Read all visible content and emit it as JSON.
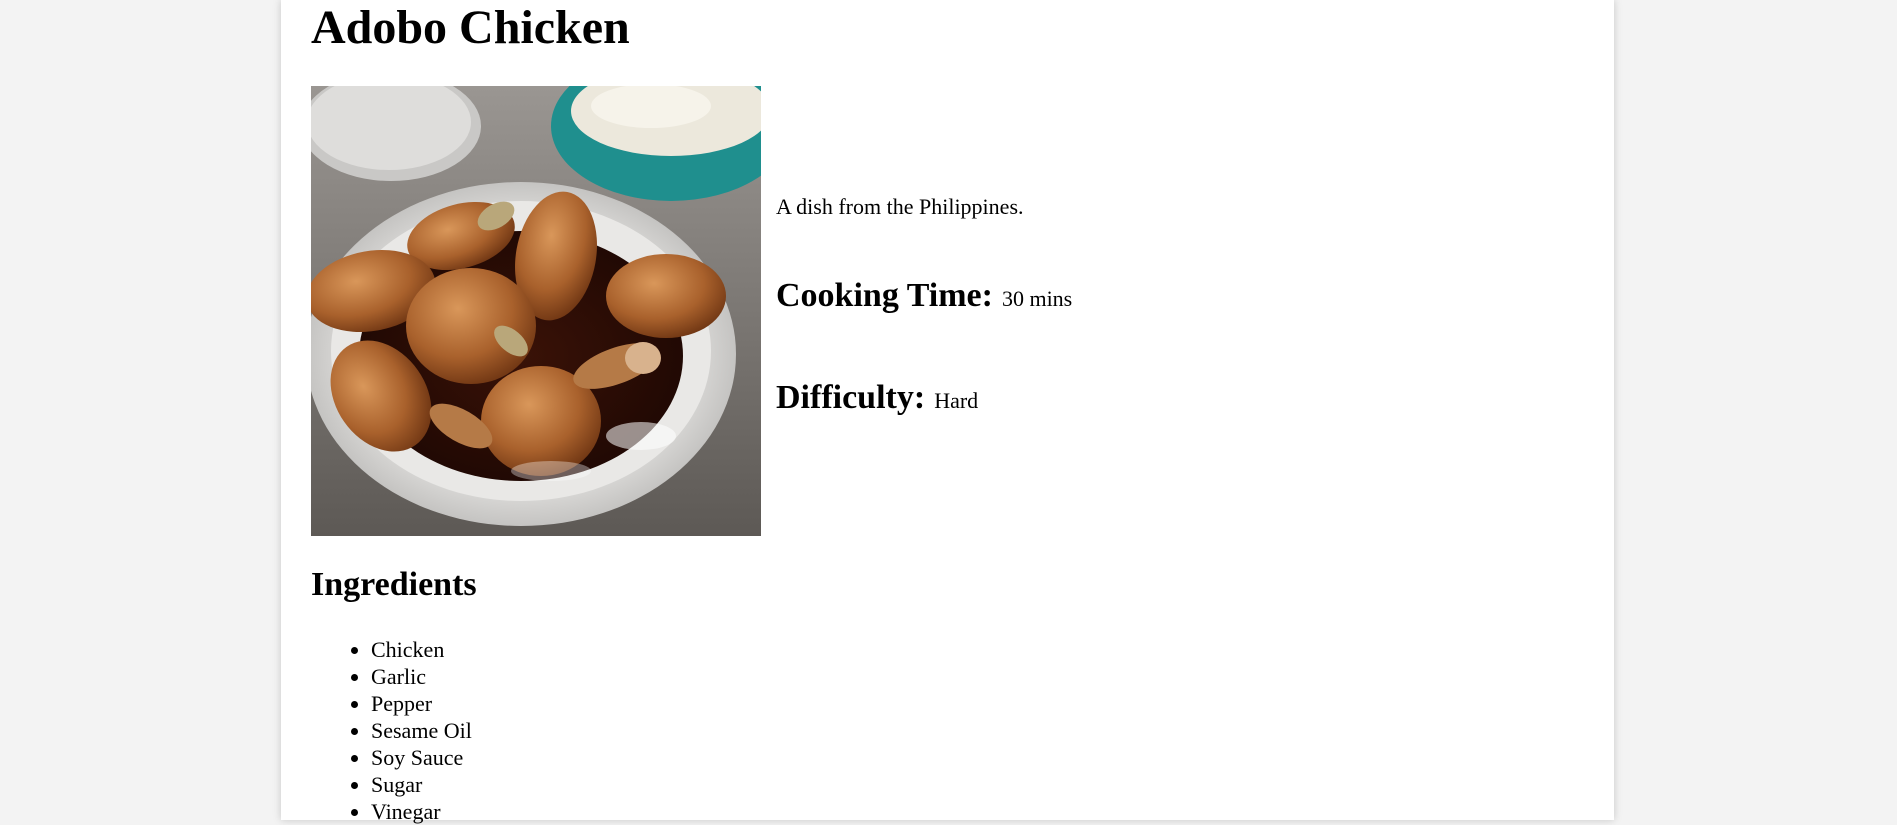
{
  "recipe": {
    "title": "Adobo Chicken",
    "description": "A dish from the Philippines.",
    "cooking_time_label": "Cooking Time:",
    "cooking_time_value": "30 mins",
    "difficulty_label": "Difficulty:",
    "difficulty_value": "Hard"
  },
  "ingredients": {
    "heading": "Ingredients",
    "items": [
      "Chicken",
      "Garlic",
      "Pepper",
      "Sesame Oil",
      "Soy Sauce",
      "Sugar",
      "Vinegar"
    ]
  },
  "colors": {
    "background": "#f3f3f3",
    "card": "#ffffff",
    "text": "#000000"
  }
}
